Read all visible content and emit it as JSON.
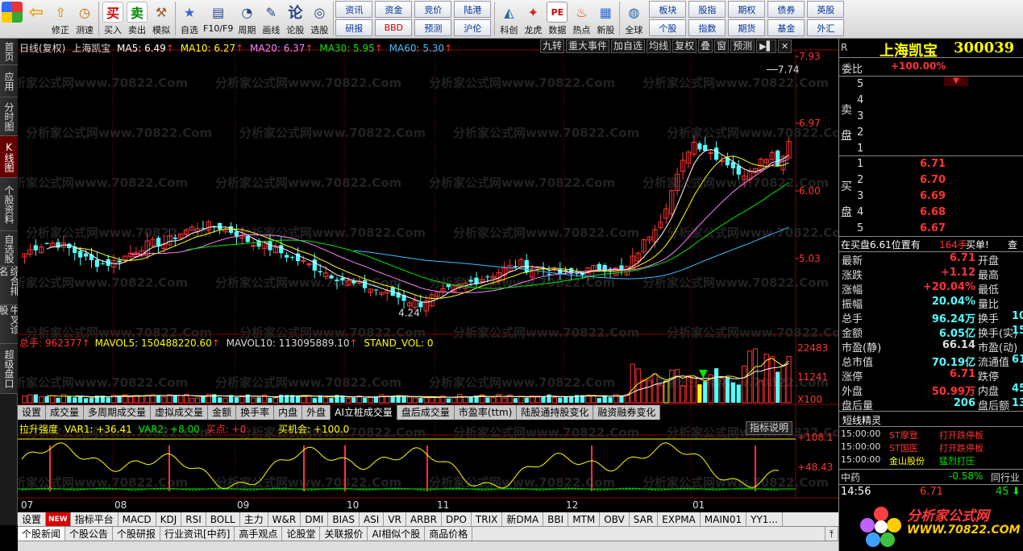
{
  "toolbar": {
    "buttons": [
      {
        "id": "home",
        "label": "",
        "icon": "grid-icon"
      },
      {
        "id": "back",
        "label": "",
        "icon": "back-arrow-icon"
      },
      {
        "id": "edit",
        "label": "修正",
        "icon": "up-arrow-icon"
      },
      {
        "id": "timing",
        "label": "测速",
        "icon": "clock-icon"
      },
      {
        "id": "buy",
        "label": "买入",
        "icon": "buy-icon",
        "glyph": "买"
      },
      {
        "id": "sell",
        "label": "卖出",
        "icon": "sell-icon",
        "glyph": "卖"
      },
      {
        "id": "sim",
        "label": "模拟",
        "icon": "hammer-icon"
      },
      {
        "id": "watch",
        "label": "自选",
        "icon": "star-icon"
      },
      {
        "id": "f10",
        "label": "F10/F9",
        "icon": "f10-icon"
      },
      {
        "id": "period",
        "label": "周期",
        "icon": "period-icon"
      },
      {
        "id": "draw",
        "label": "画线",
        "icon": "pencil-icon"
      },
      {
        "id": "stock",
        "label": "论股",
        "icon": "stock-icon",
        "glyph": "论"
      },
      {
        "id": "select",
        "label": "选股",
        "icon": "select-icon"
      }
    ],
    "grid1": [
      "资讯",
      "资金",
      "竞价",
      "陆港",
      "研报",
      "BBD",
      "预测",
      "沪伦"
    ],
    "buttons2": [
      {
        "id": "kc",
        "label": "科创",
        "icon": "chart-icon"
      },
      {
        "id": "lh",
        "label": "龙虎",
        "icon": "dragon-icon"
      },
      {
        "id": "data",
        "label": "数据",
        "icon": "pe-icon",
        "glyph": "PE"
      },
      {
        "id": "hot",
        "label": "热点",
        "icon": "fire-icon"
      },
      {
        "id": "new",
        "label": "新股",
        "icon": "newstock-icon"
      },
      {
        "id": "global",
        "label": "全球",
        "icon": "globe-icon"
      }
    ],
    "grid2": [
      "板块",
      "股指",
      "期权",
      "债券",
      "英股",
      "个股",
      "指数",
      "期货",
      "基金",
      "外汇"
    ]
  },
  "sidenav": [
    "首页",
    "应用",
    "分时图",
    "K线图",
    "个股资料",
    "自选股",
    "综合排名",
    "牛叉诊股",
    "超级盘口"
  ],
  "main_header": {
    "period": "日线(复权)",
    "stock": "上海凯宝",
    "ma5": "MA5: 6.49",
    "ma10": "MA10: 6.27",
    "ma20": "MA20: 6.37",
    "ma30": "MA30: 5.95",
    "ma60": "MA60: 5.30"
  },
  "top_tools": [
    "九转",
    "重大事件",
    "加自选",
    "均线",
    "复权",
    "叠",
    "窗",
    "预测"
  ],
  "price_axis": [
    "7.93",
    "6.97",
    "6.00",
    "5.03"
  ],
  "price_marks": {
    "high": "7.74",
    "low": "4.24"
  },
  "volume_header": {
    "total": "总手: 962377",
    "mavol5": "MAVOL5: 150488220.60",
    "mavol10": "MAVOL10: 113095889.10",
    "stand": "STAND_VOL: 0"
  },
  "volume_axis": [
    "22483",
    "11241",
    "X100"
  ],
  "ind_tabs": [
    "设置",
    "成交量",
    "多周期成交量",
    "虚拟成交量",
    "金额",
    "换手率",
    "内盘",
    "外盘",
    "AI立桩成交量",
    "盘后成交量",
    "市盈率(ttm)",
    "陆股通持股变化",
    "融资融券变化"
  ],
  "ind_active": "AI立桩成交量",
  "ind_header": {
    "name": "拉升强度",
    "var1": "VAR1: +36.41",
    "var2": "VAR2: +8.00",
    "buy": "买点: +0",
    "chance": "买机会: +100.0",
    "explain": "指标说明"
  },
  "ind_axis": [
    "+108.1",
    "+48.43"
  ],
  "dates": [
    "07",
    "08",
    "09",
    "10",
    "11",
    "12",
    "01"
  ],
  "bottom_tabs1": [
    "设置",
    "NEW",
    "指标平台",
    "MACD",
    "KDJ",
    "RSI",
    "BOLL",
    "主力",
    "W&R",
    "DMI",
    "BIAS",
    "ASI",
    "VR",
    "ARBR",
    "DPO",
    "TRIX",
    "新DMA",
    "BBI",
    "MTM",
    "OBV",
    "SAR",
    "EXPMA",
    "MAIN01",
    "YY1..."
  ],
  "bottom_tabs2": [
    "个股新闻",
    "个股公告",
    "个股研报",
    "行业资讯[中药]",
    "高手观点",
    "论股堂",
    "关联报价",
    "AI相似个股",
    "商品价格"
  ],
  "quote": {
    "badge": "R",
    "name": "上海凯宝",
    "code": "300039",
    "weibi_label": "委比",
    "weibi": "+100.00%",
    "sell_label": "卖盘",
    "sell_levels": [
      "5",
      "4",
      "3",
      "2",
      "1"
    ],
    "buy_label": "买盘",
    "buy_levels": [
      {
        "n": "1",
        "p": "6.71"
      },
      {
        "n": "2",
        "p": "6.70"
      },
      {
        "n": "3",
        "p": "6.69"
      },
      {
        "n": "4",
        "p": "6.68"
      },
      {
        "n": "5",
        "p": "6.67"
      }
    ],
    "notice": "在买盘6.61位置有",
    "notice_qty": "164手",
    "notice_tag": "买单!",
    "notice_more": "查",
    "stats": [
      {
        "l": "最新",
        "v": "6.71",
        "l2": "开盘",
        "v2": ""
      },
      {
        "l": "涨跌",
        "v": "+1.12",
        "l2": "最高",
        "v2": ""
      },
      {
        "l": "涨幅",
        "v": "+20.04%",
        "l2": "最低",
        "v2": ""
      },
      {
        "l": "振幅",
        "v": "20.04%",
        "l2": "量比",
        "v2": ""
      },
      {
        "l": "总手",
        "v": "96.24万",
        "l2": "换手",
        "v2": "10"
      },
      {
        "l": "金额",
        "v": "6.05亿",
        "l2": "换手(实)",
        "v2": "15"
      },
      {
        "l": "市盈(静)",
        "v": "66.14",
        "l2": "市盈(动)",
        "v2": ""
      },
      {
        "l": "总市值",
        "v": "70.19亿",
        "l2": "流通值",
        "v2": "61"
      },
      {
        "l": "涨停",
        "v": "6.71",
        "l2": "跌停",
        "v2": ""
      },
      {
        "l": "外盘",
        "v": "50.99万",
        "l2": "内盘",
        "v2": "45"
      },
      {
        "l": "盘后量",
        "v": "206",
        "l2": "盘后额",
        "v2": "13"
      }
    ],
    "news_title": "短线精灵",
    "news": [
      {
        "t": "15:00:00",
        "s": "ST摩登",
        "e": "打开跌停板"
      },
      {
        "t": "15:00:00",
        "s": "ST国医",
        "e": "打开跌停板"
      },
      {
        "t": "15:00:00",
        "s": "金山股份",
        "e": "猛烈打压"
      }
    ],
    "sector": "中药",
    "sector_chg": "-0.58%",
    "sector_more": "同行业",
    "tick_time": "14:56",
    "tick_price": "6.71",
    "tick_vol": "45",
    "logo": "分析家公式网",
    "logo_url": "WWW.70822.COM"
  },
  "watermark": "分析家公式网www.70822.Com",
  "colors": {
    "up": "#ff3232",
    "down": "#54ffff",
    "ma5": "#ffffff",
    "ma10": "#ffff00",
    "ma20": "#ff80ff",
    "ma30": "#00e600",
    "ma60": "#3cc0ff"
  }
}
